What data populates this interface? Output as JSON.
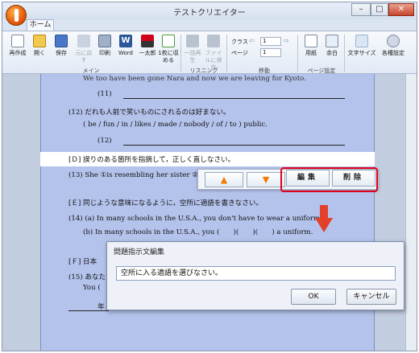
{
  "window": {
    "title": "テストクリエイター",
    "tab_home": "ホーム"
  },
  "ribbon": {
    "tools": [
      {
        "label": "再作成",
        "icon": "new-doc-icon"
      },
      {
        "label": "開く",
        "icon": "folder-open-icon"
      },
      {
        "label": "保存",
        "icon": "save-icon"
      },
      {
        "label": "元に戻す",
        "icon": "undo-icon"
      },
      {
        "label": "印刷",
        "icon": "print-icon"
      },
      {
        "label": "Word",
        "icon": "word-icon"
      },
      {
        "label": "一太郎",
        "icon": "ichitaro-icon"
      },
      {
        "label": "1枚に収める",
        "icon": "fit-page-icon"
      },
      {
        "label": "一括再生",
        "icon": "play-icon"
      },
      {
        "label": "ファイルに保存",
        "icon": "save-audio-icon"
      }
    ],
    "groups": {
      "main": "メイン",
      "listening": "リスニング",
      "move": "移動",
      "page_settings": "ページ設定"
    },
    "class_label": "クラス",
    "page_label": "ページ",
    "class_value": "1",
    "page_value": "1",
    "paper_label": "用紙",
    "margin_label": "余白",
    "font_size_label": "文字サイズ",
    "settings_label": "各種設定"
  },
  "document": {
    "line_top": "We too have been gone Nara and now we are leaving for Kyoto.",
    "q11": "(11)",
    "q12": "(12) だれも人前で笑いものにされるのは好まない。",
    "q12_words": "( be / fun / in / likes / made / nobody / of / to ) public.",
    "q12_ans": "(12)",
    "sectionD": "[Ｄ] 誤りのある箇所を指摘して，正しく直しなさい。",
    "q13": "(13) She ①is resembling her sister ②i",
    "sectionE": "[Ｅ] 同じような意味になるように，空所に適語を書きなさい。",
    "q14a": "(14) (a) In many schools in the U.S.A., you don't have to wear a uniform.",
    "q14b": "(b) In many schools in the U.S.A., you (　　)(　　)(　　) a uniform.",
    "sectionF": "[Ｆ] 日本",
    "q15": "(15) あなた",
    "q15b": "You (",
    "q16": "年"
  },
  "float_toolbar": {
    "up_arrow": "▲",
    "down_arrow": "▼",
    "edit_label": "編集",
    "delete_label": "削除"
  },
  "dialog": {
    "title": "問題指示文編集",
    "input_value": "空所に入る適語を選びなさい。",
    "ok_label": "OK",
    "cancel_label": "キャンセル"
  }
}
